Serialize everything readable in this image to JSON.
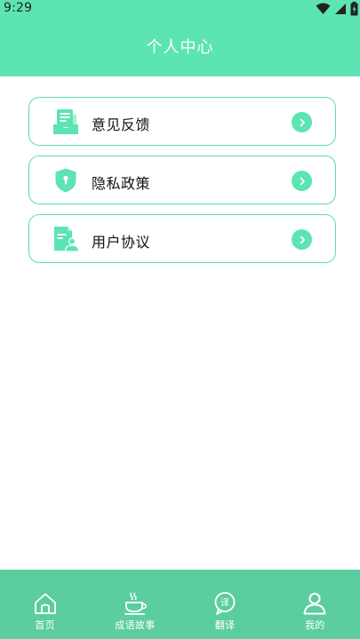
{
  "status": {
    "time": "9:29"
  },
  "header": {
    "title": "个人中心"
  },
  "menu": {
    "items": [
      {
        "label": "意见反馈",
        "icon": "feedback-icon"
      },
      {
        "label": "隐私政策",
        "icon": "shield-icon"
      },
      {
        "label": "用户协议",
        "icon": "user-agreement-icon"
      }
    ]
  },
  "bottom_nav": {
    "items": [
      {
        "label": "首页",
        "icon": "home-icon"
      },
      {
        "label": "成语故事",
        "icon": "tea-cup-icon"
      },
      {
        "label": "翻译",
        "icon": "translate-icon"
      },
      {
        "label": "我的",
        "icon": "profile-icon"
      }
    ],
    "active_index": 3
  },
  "colors": {
    "primary": "#5ce4b2",
    "nav_background": "#5ccd9e",
    "card_border": "#5ddcb0",
    "arrow_bg": "#5ce4b2"
  }
}
